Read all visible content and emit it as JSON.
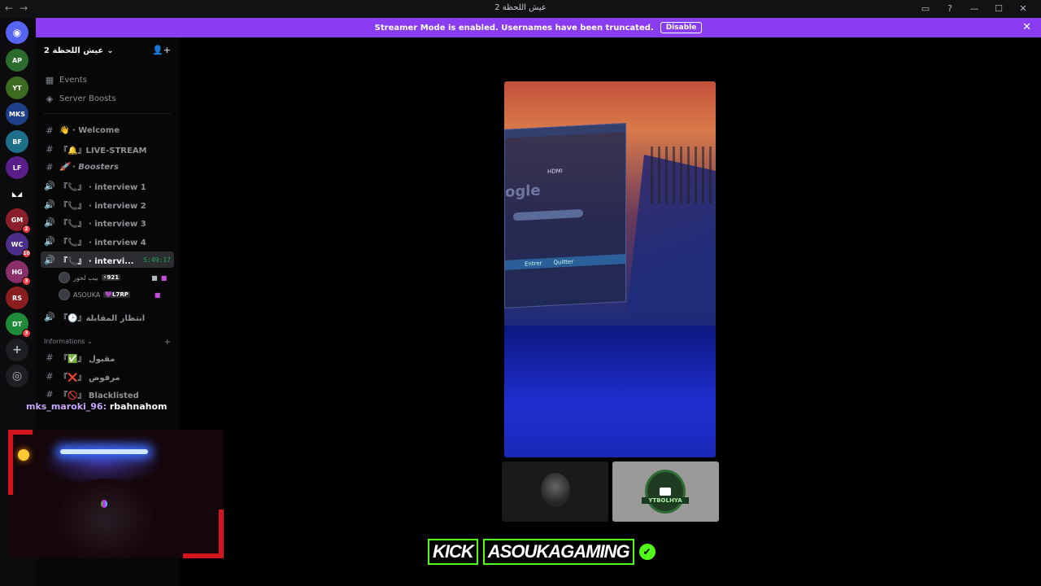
{
  "window": {
    "title": "عيش اللحظة 2",
    "nav_back": "←",
    "nav_forward": "→",
    "controls": [
      "▭",
      "?",
      "—",
      "☐",
      "✕"
    ]
  },
  "banner": {
    "message": "Streamer Mode is enabled. Usernames have been truncated.",
    "disable_label": "Disable",
    "close": "✕",
    "color": "#8a3cf0"
  },
  "rail": {
    "home_label": "◉",
    "servers": [
      {
        "label": "AP",
        "color": "#2b6b2e",
        "badge": ""
      },
      {
        "label": "YT",
        "color": "#3d6b21",
        "badge": ""
      },
      {
        "label": "MKS",
        "color": "#1f3f8a",
        "badge": ""
      },
      {
        "label": "BF",
        "color": "#1e6f8a",
        "badge": ""
      },
      {
        "label": "LF",
        "color": "#5a1e8a",
        "badge": ""
      },
      {
        "label": "◣◢",
        "color": "#0c0c0e",
        "badge": ""
      },
      {
        "label": "GM",
        "color": "#8a1e2a",
        "badge": "2"
      },
      {
        "label": "WC",
        "color": "#4a2e8a",
        "badge": "10"
      },
      {
        "label": "HG",
        "color": "#8a2e6a",
        "badge": "3"
      },
      {
        "label": "RS",
        "color": "#8a1e1e",
        "badge": ""
      },
      {
        "label": "DT",
        "color": "#1e8a3a",
        "badge": "3"
      }
    ],
    "add_label": "+",
    "discover_label": "◎"
  },
  "sidebar": {
    "guild_name": "عيش اللحظة 2",
    "guild_chevron": "⌄",
    "invite_icon": "👤+",
    "top_items": [
      {
        "icon": "▦",
        "label": "Events"
      },
      {
        "icon": "◈",
        "label": "Server Boosts"
      }
    ],
    "channels": [
      {
        "icon": "#",
        "label": "👋 · Welcome"
      },
      {
        "icon": "#",
        "label": "『🔔』LIVE-STREAM"
      },
      {
        "icon": "#",
        "label": "🚀 · Boosters"
      },
      {
        "icon": "🔊",
        "label": "『📞』 · interview 1"
      },
      {
        "icon": "🔊",
        "label": "『📞』 · interview 2"
      },
      {
        "icon": "🔊",
        "label": "『📞』 · interview 3"
      },
      {
        "icon": "🔊",
        "label": "『📞』 · interview 4"
      }
    ],
    "active_channel": {
      "icon": "🔊",
      "label": "『📞』 · intervi...",
      "timer": "5:49:17"
    },
    "voice_users": [
      {
        "name": "بيب لحور",
        "tag": "⚡921"
      },
      {
        "name": "ASOUKA",
        "tag": "💜L7RP"
      }
    ],
    "waiting_channel": {
      "icon": "🔊",
      "label": "『🕒』انتظار المقابلة"
    },
    "category": {
      "label": "Informations ⌄",
      "plus": "+"
    },
    "info_channels": [
      {
        "icon": "#",
        "label": "『✅』 مقبول"
      },
      {
        "icon": "#",
        "label": "『❌』 مرفوض"
      },
      {
        "icon": "#",
        "label": "『🚫』 Blacklisted"
      }
    ]
  },
  "chat_overlay": {
    "user": "mks_maroki_96:",
    "message": "rbahnahom"
  },
  "stream": {
    "win_text": "HDMI",
    "win_logo": "ogle",
    "win_buttons": [
      "Entrer",
      "Quitter"
    ]
  },
  "thumbs": {
    "logo_text": "YTBOLHYA"
  },
  "kick": {
    "brand": "KICK",
    "channel": "ASOUKAGAMING",
    "check": "✔",
    "color": "#53fc18"
  }
}
